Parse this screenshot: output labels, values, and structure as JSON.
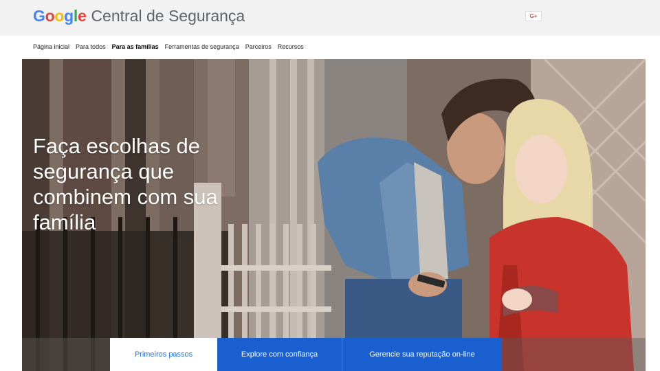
{
  "header": {
    "logo_letters": [
      {
        "char": "G",
        "color": "#4285F4"
      },
      {
        "char": "o",
        "color": "#EA4335"
      },
      {
        "char": "o",
        "color": "#FBBC05"
      },
      {
        "char": "g",
        "color": "#4285F4"
      },
      {
        "char": "l",
        "color": "#34A853"
      },
      {
        "char": "e",
        "color": "#EA4335"
      }
    ],
    "product_name": "Central de Segurança",
    "gplus_label": "G+",
    "gplus_icon": "google-plus-icon"
  },
  "nav": {
    "items": [
      {
        "label": "Página inicial",
        "active": false
      },
      {
        "label": "Para todos",
        "active": false
      },
      {
        "label": "Para as famílias",
        "active": true
      },
      {
        "label": "Ferramentas de segurança",
        "active": false
      },
      {
        "label": "Parceiros",
        "active": false
      },
      {
        "label": "Recursos",
        "active": false
      }
    ]
  },
  "hero": {
    "title": "Faça escolhas de segurança que combinem com sua família"
  },
  "tabs": [
    {
      "label": "Primeiros passos",
      "selected": true
    },
    {
      "label": "Explore com confiança",
      "selected": false
    },
    {
      "label": "Gerencie sua reputação on-line",
      "selected": false
    }
  ],
  "colors": {
    "tab_blue": "#1a5fd0",
    "link_blue": "#1a73e8",
    "header_bg": "#f2f2f2"
  }
}
